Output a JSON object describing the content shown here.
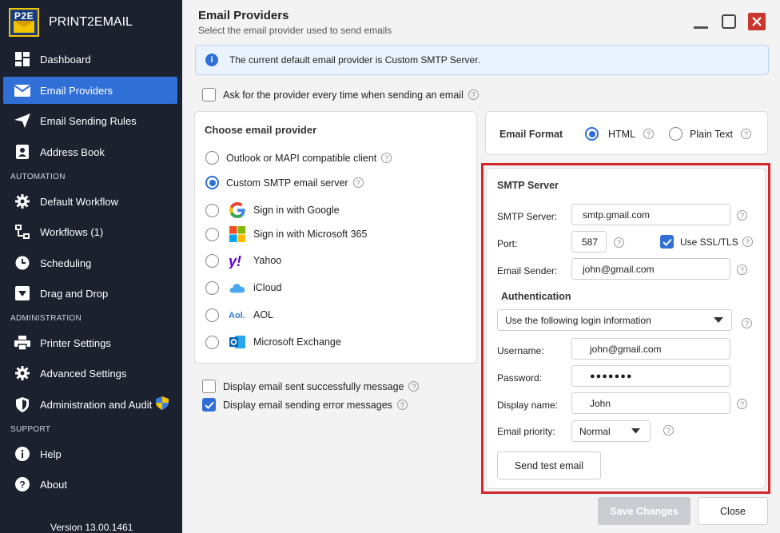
{
  "app": {
    "logo_text": "P2E",
    "name": "PRINT2EMAIL",
    "version": "Version 13.00.1461"
  },
  "sidebar": {
    "items": [
      {
        "label": "Dashboard"
      },
      {
        "label": "Email Providers"
      },
      {
        "label": "Email Sending Rules"
      },
      {
        "label": "Address Book"
      }
    ],
    "section_automation": "AUTOMATION",
    "automation_items": [
      {
        "label": "Default Workflow"
      },
      {
        "label": "Workflows (1)"
      },
      {
        "label": "Scheduling"
      },
      {
        "label": "Drag and Drop"
      }
    ],
    "section_administration": "ADMINISTRATION",
    "administration_items": [
      {
        "label": "Printer Settings"
      },
      {
        "label": "Advanced Settings"
      },
      {
        "label": "Administration and Audit"
      }
    ],
    "section_support": "SUPPORT",
    "support_items": [
      {
        "label": "Help"
      },
      {
        "label": "About"
      }
    ]
  },
  "header": {
    "title": "Email Providers",
    "subtitle": "Select the email provider used to send emails"
  },
  "info_banner": "The current default email provider is Custom SMTP Server.",
  "ask_provider_label": "Ask for the provider every time when sending an email",
  "provider_panel": {
    "title": "Choose email provider",
    "options": [
      {
        "label": "Outlook or MAPI compatible client"
      },
      {
        "label": "Custom SMTP email server"
      },
      {
        "label": "Sign in with Google"
      },
      {
        "label": "Sign in with Microsoft 365"
      },
      {
        "label": "Yahoo"
      },
      {
        "label": "iCloud"
      },
      {
        "label": "AOL"
      },
      {
        "label": "Microsoft Exchange"
      }
    ],
    "selected": "Custom SMTP email server"
  },
  "display_success_label": "Display email sent successfully message",
  "display_error_label": "Display email sending error messages",
  "email_format": {
    "label": "Email Format",
    "html_label": "HTML",
    "plain_label": "Plain Text",
    "selected": "HTML"
  },
  "smtp": {
    "title": "SMTP Server",
    "server_label": "SMTP Server:",
    "server_value": "smtp.gmail.com",
    "port_label": "Port:",
    "port_value": "587",
    "ssl_label": "Use SSL/TLS",
    "sender_label": "Email Sender:",
    "sender_value": "john@gmail.com",
    "auth_title": "Authentication",
    "auth_option": "Use the following login information",
    "username_label": "Username:",
    "username_value": "john@gmail.com",
    "password_label": "Password:",
    "password_value": "●●●●●●●",
    "display_name_label": "Display name:",
    "display_name_value": "John",
    "priority_label": "Email priority:",
    "priority_value": "Normal",
    "test_button": "Send test email"
  },
  "footer": {
    "save_label": "Save Changes",
    "close_label": "Close"
  },
  "colors": {
    "sidebar_bg": "#1c2130",
    "accent": "#2f6fd6",
    "highlight_border": "#d3262b",
    "close_button": "#c8382f"
  }
}
